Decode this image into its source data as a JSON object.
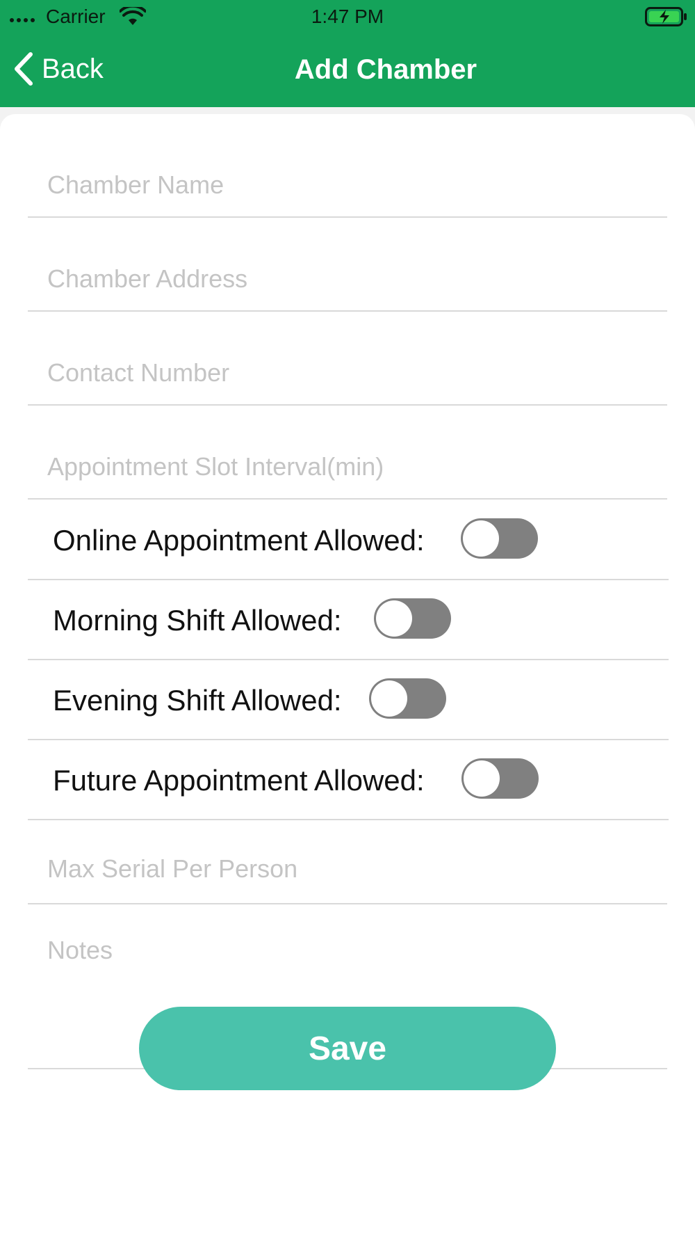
{
  "status_bar": {
    "carrier": "Carrier",
    "time": "1:47 PM",
    "wifi_icon": "wifi-icon",
    "battery_icon": "battery-charging-icon"
  },
  "nav": {
    "back_label": "Back",
    "back_icon": "chevron-left-icon",
    "title": "Add Chamber"
  },
  "form": {
    "chamber_name": {
      "placeholder": "Chamber Name",
      "value": ""
    },
    "chamber_address": {
      "placeholder": "Chamber Address",
      "value": ""
    },
    "contact_number": {
      "placeholder": "Contact Number",
      "value": ""
    },
    "slot_interval": {
      "placeholder": "Appointment Slot Interval(min)",
      "value": ""
    },
    "toggles": [
      {
        "label": "Online Appointment Allowed:",
        "on": false
      },
      {
        "label": "Morning Shift Allowed:",
        "on": false
      },
      {
        "label": "Evening Shift Allowed:",
        "on": false
      },
      {
        "label": "Future Appointment Allowed:",
        "on": false
      }
    ],
    "max_serial": {
      "placeholder": "Max Serial Per Person",
      "value": ""
    },
    "notes": {
      "placeholder": "Notes",
      "value": ""
    },
    "save_label": "Save"
  },
  "colors": {
    "header": "#14a35a",
    "save_button": "#4ac2ab",
    "switch_off": "#808080"
  }
}
